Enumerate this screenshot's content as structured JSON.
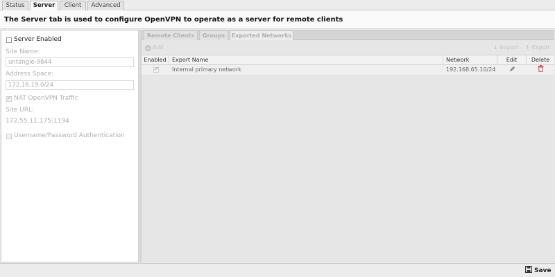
{
  "tabs": [
    {
      "label": "Status"
    },
    {
      "label": "Server"
    },
    {
      "label": "Client"
    },
    {
      "label": "Advanced"
    }
  ],
  "description": "The Server tab is used to configure OpenVPN to operate as a server for remote clients",
  "left_panel": {
    "server_enabled_label": "Server Enabled",
    "server_enabled_checked": false,
    "site_name_label": "Site Name:",
    "site_name_value": "untangle-9844",
    "address_space_label": "Address Space:",
    "address_space_value": "172.16.19.0/24",
    "nat_label": "NAT OpenVPN Traffic",
    "nat_checked": true,
    "site_url_label": "Site URL:",
    "site_url_value": "172.55.11.175:1194",
    "userpass_label": "Username/Password Authentication",
    "userpass_checked": false
  },
  "sub_tabs": [
    {
      "label": "Remote Clients"
    },
    {
      "label": "Groups"
    },
    {
      "label": "Exported Networks"
    }
  ],
  "grid_toolbar": {
    "add_label": "Add",
    "import_label": "Import",
    "export_label": "Export"
  },
  "grid": {
    "columns": [
      "Enabled",
      "Export Name",
      "Network",
      "Edit",
      "Delete"
    ],
    "rows": [
      {
        "enabled": true,
        "name": "Internal primary network",
        "network": "192.168.65.10/24"
      }
    ]
  },
  "footer": {
    "save_label": "Save"
  },
  "colors": {
    "delete_icon": "#e05050",
    "edit_icon": "#888888"
  }
}
